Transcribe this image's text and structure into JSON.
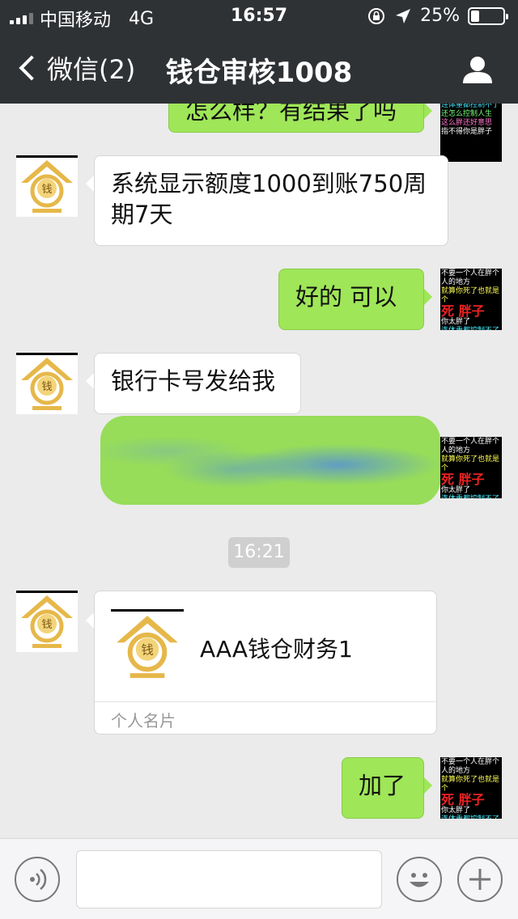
{
  "status_bar": {
    "carrier": "中国移动",
    "network": "4G",
    "time": "16:57",
    "battery": "25%",
    "battery_level": 0.25
  },
  "nav": {
    "back_label": "微信(2)",
    "title": "钱仓审核1008"
  },
  "contact_logo_char": "钱",
  "sticker_lines": [
    "不要一个人在胖个人的地方",
    "就算你死了也就是个",
    "死 胖子",
    "你太胖了",
    "连体重都控制不了",
    "还怎么控制人生",
    "这么胖还好意思",
    "指不得你是胖子"
  ],
  "messages": [
    {
      "side": "out",
      "text": "怎么样？有结果了吗"
    },
    {
      "side": "in",
      "text": "系统显示额度1000到账750周期7天"
    },
    {
      "side": "out",
      "text": "好的  可以"
    },
    {
      "side": "in",
      "text": "银行卡号发给我"
    }
  ],
  "timestamp": "16:21",
  "contact_card": {
    "name": "AAA钱仓财务1",
    "label": "个人名片"
  },
  "last_message": {
    "side": "out",
    "text": "加了"
  },
  "input": {
    "placeholder": ""
  }
}
